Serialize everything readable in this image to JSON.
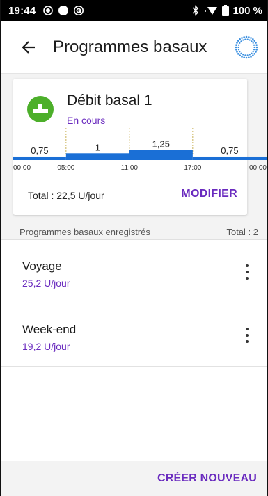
{
  "status_bar": {
    "time": "19:44",
    "battery": "100 %",
    "icons": [
      "status-dot-icon",
      "record-icon",
      "sync-icon",
      "bluetooth-icon",
      "wifi-icon",
      "battery-icon"
    ]
  },
  "app_bar": {
    "back_icon": "back-arrow-icon",
    "title": "Programmes basaux",
    "logo_icon": "pod-logo-icon"
  },
  "active_program": {
    "name": "Débit basal 1",
    "status": "En cours",
    "icon": "active-program-icon",
    "total": "Total : 22,5 U/jour",
    "modify_label": "MODIFIER"
  },
  "chart_data": {
    "type": "bar",
    "segments": [
      {
        "start": "00:00",
        "end": "05:00",
        "value": 0.75,
        "label": "0,75"
      },
      {
        "start": "05:00",
        "end": "11:00",
        "value": 1,
        "label": "1"
      },
      {
        "start": "11:00",
        "end": "17:00",
        "value": 1.25,
        "label": "1,25"
      },
      {
        "start": "17:00",
        "end": "24:00",
        "value": 0.75,
        "label": "0,75"
      }
    ],
    "tick_labels": [
      "00:00",
      "05:00",
      "11:00",
      "17:00",
      "00:00"
    ],
    "bar_color": "#1a6fd6"
  },
  "saved_section": {
    "title": "Programmes basaux enregistrés",
    "count": "Total : 2"
  },
  "saved_programs": [
    {
      "name": "Voyage",
      "rate": "25,2 U/jour"
    },
    {
      "name": "Week-end",
      "rate": "19,2 U/jour"
    }
  ],
  "create_label": "CRÉER NOUVEAU",
  "colors": {
    "accent": "#6a2bbf",
    "active_green": "#4caf2a",
    "chart_blue": "#1a6fd6"
  }
}
